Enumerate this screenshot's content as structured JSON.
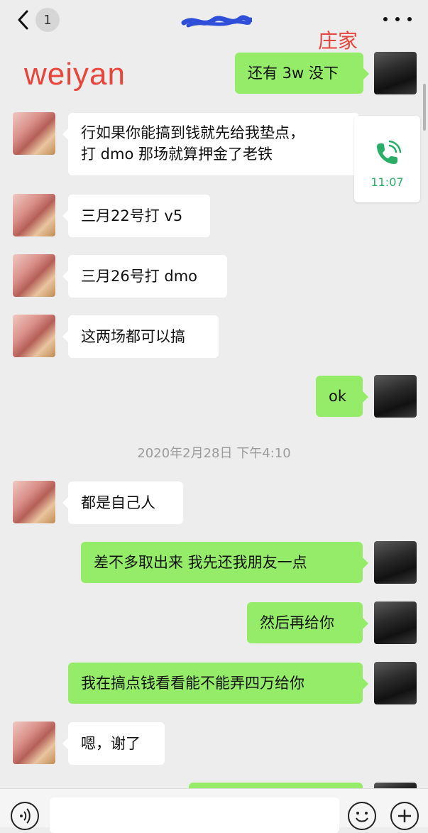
{
  "header": {
    "back_label": "<",
    "unread_count": "1",
    "title": "",
    "more_label": "..."
  },
  "annotations": {
    "peer_label": "weiyan",
    "self_label": "庄家"
  },
  "messages": [
    {
      "side": "self",
      "text": "还有 3w 没下"
    },
    {
      "side": "peer",
      "lines": [
        "行如果你能搞到钱就先给我垫点，",
        "打 dmo 那场就算押金了老铁"
      ]
    },
    {
      "side": "peer",
      "text": "三月22号打 v5"
    },
    {
      "side": "peer",
      "text": "三月26号打 dmo"
    },
    {
      "side": "peer",
      "text": "这两场都可以搞"
    },
    {
      "side": "self",
      "text": "ok"
    },
    {
      "side": "peer",
      "text": "都是自己人"
    },
    {
      "side": "self",
      "text": "差不多取出来 我先还我朋友一点"
    },
    {
      "side": "self",
      "text": "然后再给你"
    },
    {
      "side": "self",
      "text": "我在搞点钱看看能不能弄四万给你"
    },
    {
      "side": "peer",
      "text": "嗯，谢了"
    }
  ],
  "call_card": {
    "icon": "phone-call-icon",
    "time": "11:07"
  },
  "timestamp": "2020年2月28日 下午4:10",
  "input_bar": {
    "placeholder": "",
    "voice_icon": "voice-icon",
    "emoji_icon": "emoji-icon",
    "plus_icon": "plus-icon"
  },
  "colors": {
    "background": "#ededed",
    "self_bubble": "#95ec69",
    "peer_bubble": "#ffffff",
    "annotation": "#e8453c",
    "call_green": "#2aae67"
  }
}
